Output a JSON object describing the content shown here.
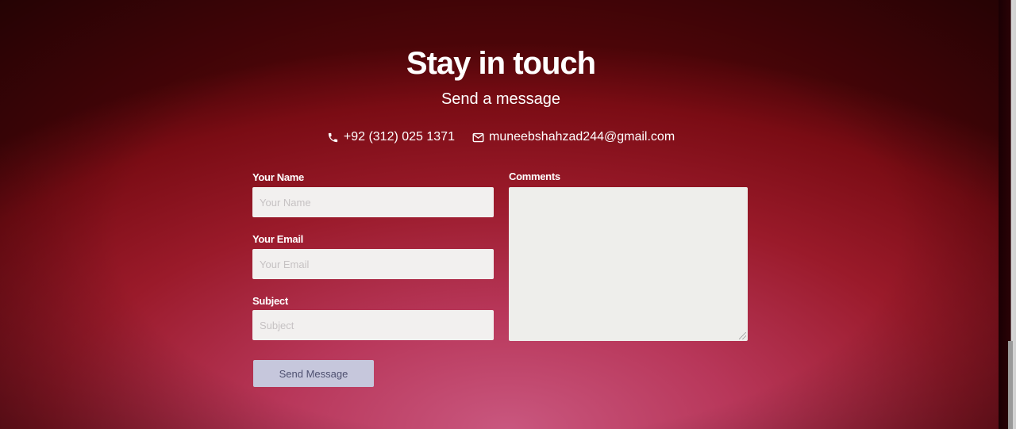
{
  "header": {
    "title": "Stay in touch",
    "subtitle": "Send a message"
  },
  "contacts": {
    "phone": {
      "icon": "phone-icon",
      "text": "+92 (312) 025 1371"
    },
    "email": {
      "icon": "mail-icon",
      "text": "muneebshahzad244@gmail.com"
    }
  },
  "form": {
    "name": {
      "label": "Your Name",
      "placeholder": "Your Name",
      "value": ""
    },
    "email": {
      "label": "Your Email",
      "placeholder": "Your Email",
      "value": ""
    },
    "subject": {
      "label": "Subject",
      "placeholder": "Subject",
      "value": ""
    },
    "comments": {
      "label": "Comments",
      "value": ""
    },
    "submit_label": "Send Message"
  },
  "colors": {
    "background_primary": "#9a1a2a",
    "background_glow": "#c9577f",
    "text": "#ffffff",
    "input_bg": "#f2f0ef",
    "button_bg": "#c6c7dc",
    "button_text": "#4e5070"
  }
}
